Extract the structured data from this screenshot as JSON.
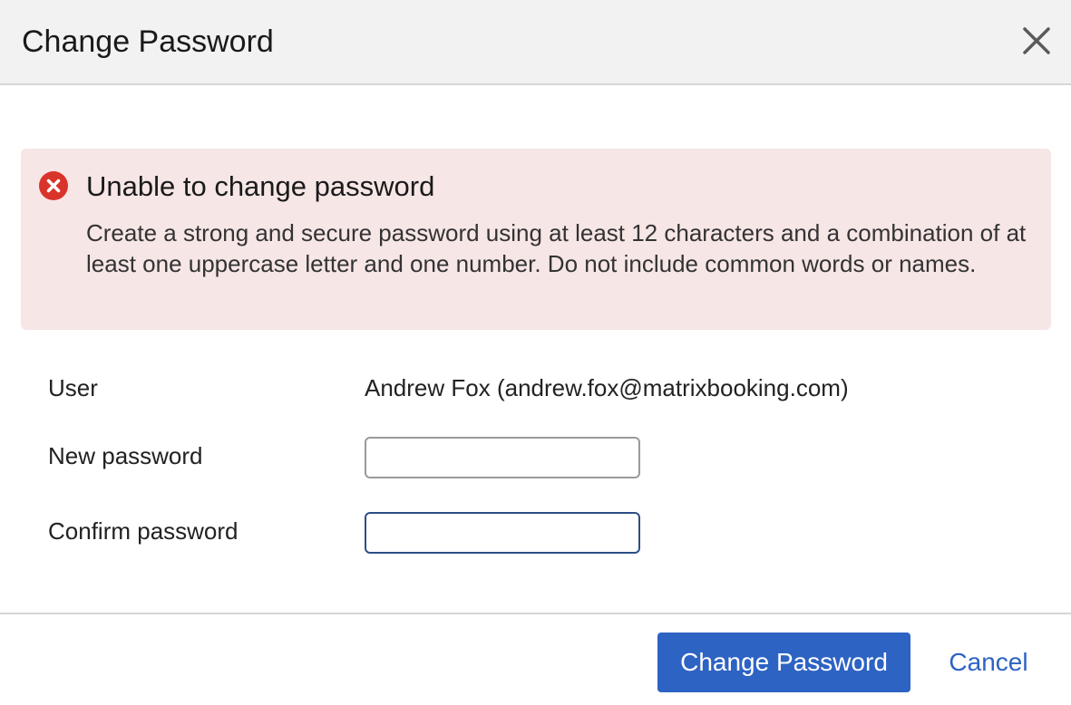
{
  "dialog": {
    "title": "Change Password",
    "close_icon": "close-icon"
  },
  "alert": {
    "icon": "error-circle-icon",
    "title": "Unable to change password",
    "message": "Create a strong and secure password using at least 12 characters and a combination of at least one uppercase letter and one number. Do not include common words or names.",
    "background_color": "#f7e6e6",
    "icon_color": "#d9342b"
  },
  "form": {
    "user_label": "User",
    "user_value": "Andrew Fox (andrew.fox@matrixbooking.com)",
    "new_password_label": "New password",
    "new_password_value": "",
    "confirm_password_label": "Confirm password",
    "confirm_password_value": ""
  },
  "footer": {
    "primary_label": "Change Password",
    "cancel_label": "Cancel",
    "accent_color": "#2d63c3"
  }
}
